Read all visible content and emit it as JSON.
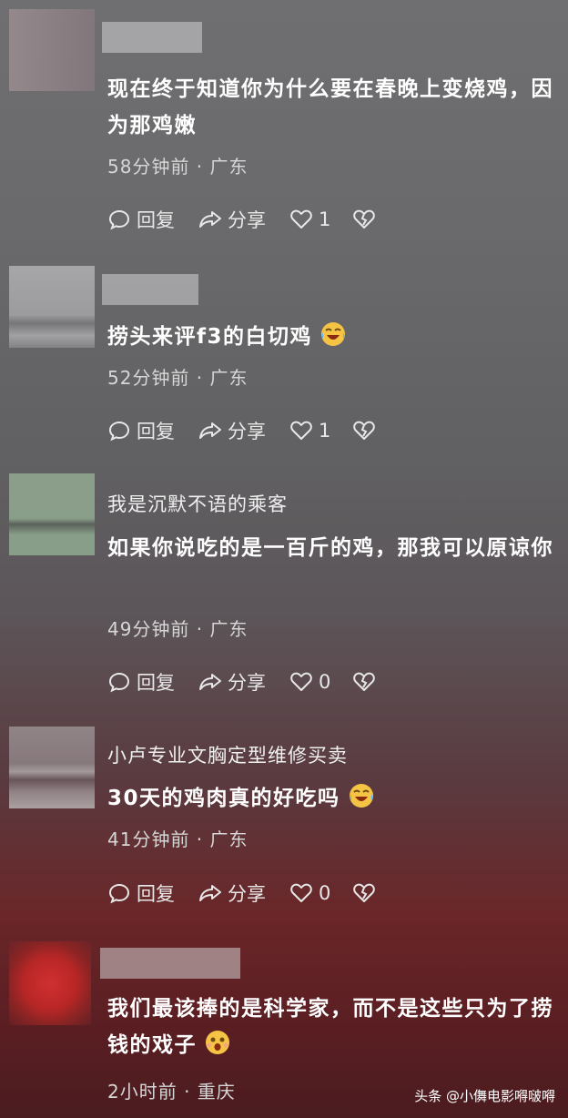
{
  "comments": [
    {
      "username": "",
      "text": "现在终于知道你为什么要在春晚上变烧鸡，因为那鸡嫩",
      "meta": "58分钟前 · 广东",
      "reply_label": "回复",
      "share_label": "分享",
      "likes": "1"
    },
    {
      "username": "",
      "text": "捞头来评f3的白切鸡",
      "meta": "52分钟前 · 广东",
      "reply_label": "回复",
      "share_label": "分享",
      "likes": "1",
      "emoji": "laughing-crying-emoji"
    },
    {
      "username": "我是沉默不语的乘客",
      "text": "如果你说吃的是一百斤的鸡，那我可以原谅你",
      "meta": "49分钟前 · 广东",
      "reply_label": "回复",
      "share_label": "分享",
      "likes": "0"
    },
    {
      "username": "小卢专业文胸定型维修买卖",
      "text": "30天的鸡肉真的好吃吗",
      "meta": "41分钟前 · 广东",
      "reply_label": "回复",
      "share_label": "分享",
      "likes": "0",
      "emoji": "laughing-crying-emoji"
    },
    {
      "username": "",
      "text": "我们最该捧的是科学家，而不是这些只为了捞钱的戏子",
      "meta": "2小时前 · 重庆",
      "emoji": "shocked-emoji"
    }
  ],
  "watermark": "头条 @小儛电影嘚啵嘚",
  "colors": {
    "background_top": "#6f6f71",
    "background_bottom": "#4a1c20"
  }
}
